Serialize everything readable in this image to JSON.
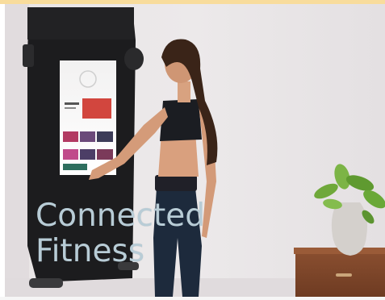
{
  "caption": {
    "line1": "Connected",
    "line2": "Fitness"
  },
  "colors": {
    "accent_bar": "#f8dc9c",
    "caption_text": "#b8ccd6"
  }
}
